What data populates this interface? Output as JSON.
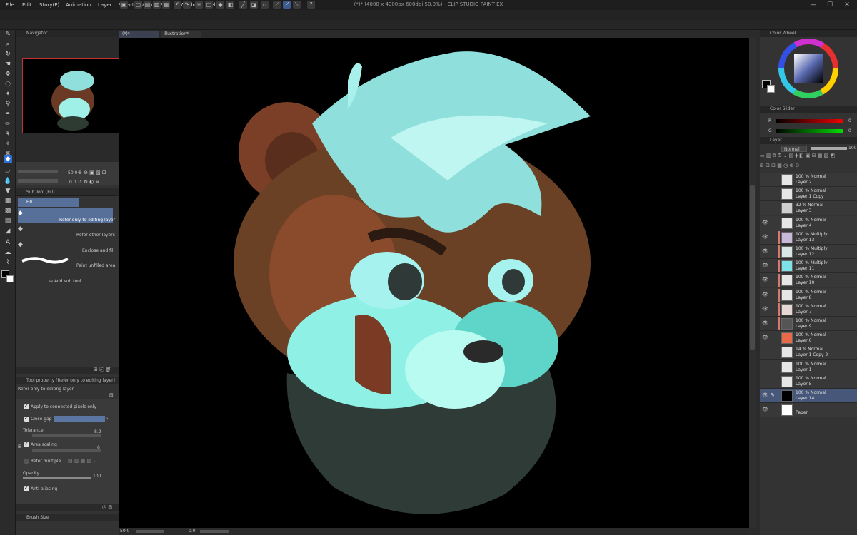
{
  "window": {
    "title": "\"(中)\" (4000 x 4000px 600dpi 50.0%)  - CLIP STUDIO PAINT EX",
    "title_display": "(*)* (4000 x 4000px 600dpi 50.0%)  - CLIP STUDIO PAINT EX",
    "minimize": "—",
    "maximize": "☐",
    "close": "✕"
  },
  "menu": [
    "File",
    "Edit",
    "Story(P)",
    "Animation",
    "Layer",
    "Select",
    "View",
    "Filter",
    "Window",
    "Help"
  ],
  "tabs": [
    {
      "label": "(*)*"
    },
    {
      "label": "Illustration*"
    }
  ],
  "navigator": {
    "title": "Navigator",
    "zoom": "50.0",
    "rotation": "0.0"
  },
  "subtool": {
    "title": "Sub Tool [Fill]",
    "group": "Fill",
    "items": [
      {
        "label": "Refer only to editing layer"
      },
      {
        "label": "Refer other layers"
      },
      {
        "label": "Enclose and fill"
      },
      {
        "label": "Paint unfilled area"
      }
    ],
    "add": "Add sub tool"
  },
  "toolprop": {
    "title": "Tool property [Refer only to editing layer]",
    "name": "Refer only to editing layer",
    "apply_connected": "Apply to connected pixels only",
    "close_gap": "Close gap",
    "tolerance_label": "Tolerance",
    "tolerance_value": "8.2",
    "area_scaling_label": "Area scaling",
    "area_scaling_value": "6",
    "refer_multiple": "Refer multiple",
    "opacity_label": "Opacity",
    "opacity_value": "100",
    "anti_aliasing": "Anti-aliasing"
  },
  "brushsize": {
    "title": "Brush Size"
  },
  "status": {
    "zoom": "50.0",
    "angle": "0.0"
  },
  "colorwheel": {
    "title": "Color Wheel"
  },
  "colorslider": {
    "title": "Color Slider",
    "r_label": "R",
    "r_value": "0",
    "g_label": "G",
    "g_value": "0"
  },
  "layerpanel": {
    "title": "Layer",
    "blend": "Normal",
    "opacity": "100"
  },
  "layers": [
    {
      "mode": "100 % Normal",
      "name": "Layer 2",
      "visible": false,
      "clip": false,
      "thumb": "#e6e6e6"
    },
    {
      "mode": "100 % Normal",
      "name": "Layer 1 Copy",
      "visible": false,
      "clip": false,
      "thumb": "#e6e6e6"
    },
    {
      "mode": "32 % Normal",
      "name": "Layer 3",
      "visible": false,
      "clip": false,
      "thumb": "#cfcfcf"
    },
    {
      "mode": "100 % Normal",
      "name": "Layer 4",
      "visible": true,
      "clip": false,
      "thumb": "#e6e6e6"
    },
    {
      "mode": "100 % Multiply",
      "name": "Layer 13",
      "visible": true,
      "clip": true,
      "thumb": "#c9b9d9"
    },
    {
      "mode": "100 % Multiply",
      "name": "Layer 12",
      "visible": true,
      "clip": true,
      "thumb": "#d9e6e6"
    },
    {
      "mode": "100 % Multiply",
      "name": "Layer 11",
      "visible": true,
      "clip": true,
      "thumb": "#7de3e6"
    },
    {
      "mode": "100 % Normal",
      "name": "Layer 10",
      "visible": true,
      "clip": true,
      "thumb": "#e6e6e6"
    },
    {
      "mode": "100 % Normal",
      "name": "Layer 8",
      "visible": true,
      "clip": true,
      "thumb": "#e6e6e6"
    },
    {
      "mode": "100 % Normal",
      "name": "Layer 7",
      "visible": true,
      "clip": true,
      "thumb": "#e6d6d6"
    },
    {
      "mode": "100 % Normal",
      "name": "Layer 9",
      "visible": true,
      "clip": true,
      "thumb": "#555555"
    },
    {
      "mode": "100 % Normal",
      "name": "Layer 6",
      "visible": true,
      "clip": false,
      "thumb": "#e86a4a"
    },
    {
      "mode": "14 % Normal",
      "name": "Layer 1 Copy 2",
      "visible": false,
      "clip": false,
      "thumb": "#e6e6e6"
    },
    {
      "mode": "100 % Normal",
      "name": "Layer 1",
      "visible": false,
      "clip": false,
      "thumb": "#e6e6e6"
    },
    {
      "mode": "100 % Normal",
      "name": "Layer 5",
      "visible": false,
      "clip": false,
      "thumb": "#e6e6e6"
    },
    {
      "mode": "100 % Normal",
      "name": "Layer 14",
      "visible": true,
      "clip": false,
      "thumb": "#000000",
      "selected": true
    },
    {
      "mode": "",
      "name": "Paper",
      "visible": true,
      "clip": false,
      "thumb": "#ffffff"
    }
  ],
  "colors": {
    "accent": "#2f6fd6",
    "selected_row": "#47577a",
    "clip_marker": "#d9786f"
  }
}
